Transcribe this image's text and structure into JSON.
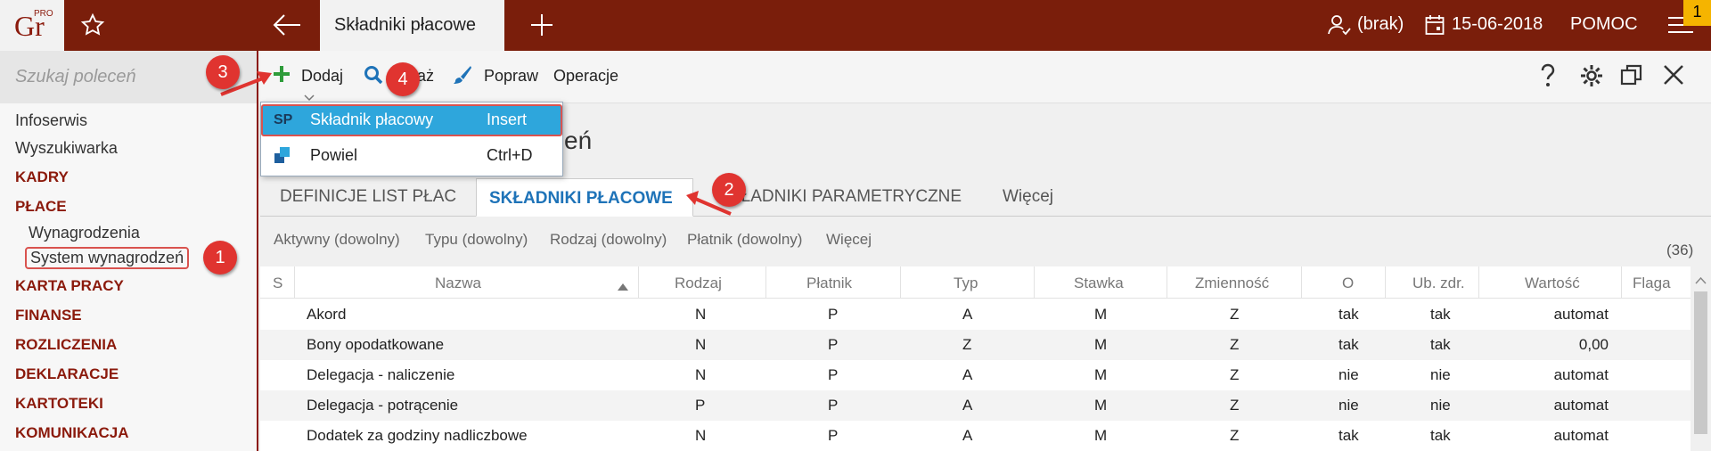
{
  "app": {
    "logo_text": "Gr",
    "logo_sup": "PRO"
  },
  "topbar": {
    "active_tab": "Składniki płacowe",
    "user": "(brak)",
    "date": "15-06-2018",
    "help": "POMOC",
    "badge": "1"
  },
  "search": {
    "placeholder": "Szukaj poleceń"
  },
  "sidebar": {
    "items": [
      {
        "label": "Infoserwis"
      },
      {
        "label": "Wyszukiwarka"
      },
      {
        "label": "KADRY"
      },
      {
        "label": "PŁACE"
      },
      {
        "label": "Wynagrodzenia"
      },
      {
        "label": "System wynagrodzeń"
      },
      {
        "label": "KARTA PRACY"
      },
      {
        "label": "FINANSE"
      },
      {
        "label": "ROZLICZENIA"
      },
      {
        "label": "DEKLARACJE"
      },
      {
        "label": "KARTOTEKI"
      },
      {
        "label": "KOMUNIKACJA"
      }
    ]
  },
  "toolbar": {
    "add": "Dodaj",
    "show": "Pokaż",
    "edit": "Popraw",
    "operations": "Operacje"
  },
  "dropdown": {
    "items": [
      {
        "badge": "SP",
        "label": "Składnik płacowy",
        "shortcut": "Insert"
      },
      {
        "label": "Powiel",
        "shortcut": "Ctrl+D"
      }
    ]
  },
  "page": {
    "heading_fragment": "eń"
  },
  "tabs": [
    {
      "label": "DEFINICJE LIST PŁAC"
    },
    {
      "label": "SKŁADNIKI PŁACOWE"
    },
    {
      "label": "KŁADNIKI PARAMETRYCZNE"
    },
    {
      "label": "Więcej"
    }
  ],
  "filters": [
    "Aktywny (dowolny)",
    "Typu (dowolny)",
    "Rodzaj (dowolny)",
    "Płatnik (dowolny)",
    "Więcej"
  ],
  "count": "(36)",
  "table": {
    "columns": [
      "S",
      "Nazwa",
      "Rodzaj",
      "Płatnik",
      "Typ",
      "Stawka",
      "Zmienność",
      "O",
      "Ub. zdr.",
      "Wartość",
      "Flaga"
    ],
    "rows": [
      {
        "nazwa": "Akord",
        "rodzaj": "N",
        "platnik": "P",
        "typ": "A",
        "stawka": "M",
        "zmiennosc": "Z",
        "o": "tak",
        "ub": "tak",
        "wartosc": "automat"
      },
      {
        "nazwa": "Bony opodatkowane",
        "rodzaj": "N",
        "platnik": "P",
        "typ": "Z",
        "stawka": "M",
        "zmiennosc": "Z",
        "o": "tak",
        "ub": "tak",
        "wartosc": "0,00"
      },
      {
        "nazwa": "Delegacja - naliczenie",
        "rodzaj": "N",
        "platnik": "P",
        "typ": "A",
        "stawka": "M",
        "zmiennosc": "Z",
        "o": "nie",
        "ub": "nie",
        "wartosc": "automat"
      },
      {
        "nazwa": "Delegacja - potrącenie",
        "rodzaj": "P",
        "platnik": "P",
        "typ": "A",
        "stawka": "M",
        "zmiennosc": "Z",
        "o": "nie",
        "ub": "nie",
        "wartosc": "automat"
      },
      {
        "nazwa": "Dodatek za godziny nadliczbowe",
        "rodzaj": "N",
        "platnik": "P",
        "typ": "A",
        "stawka": "M",
        "zmiennosc": "Z",
        "o": "tak",
        "ub": "tak",
        "wartosc": "automat"
      }
    ]
  },
  "markers": [
    "1",
    "2",
    "3",
    "4"
  ],
  "colors": {
    "brand": "#7a1e0b",
    "accent_blue": "#1e73b8",
    "selection": "#2ea6dc",
    "marker": "#e03430"
  }
}
